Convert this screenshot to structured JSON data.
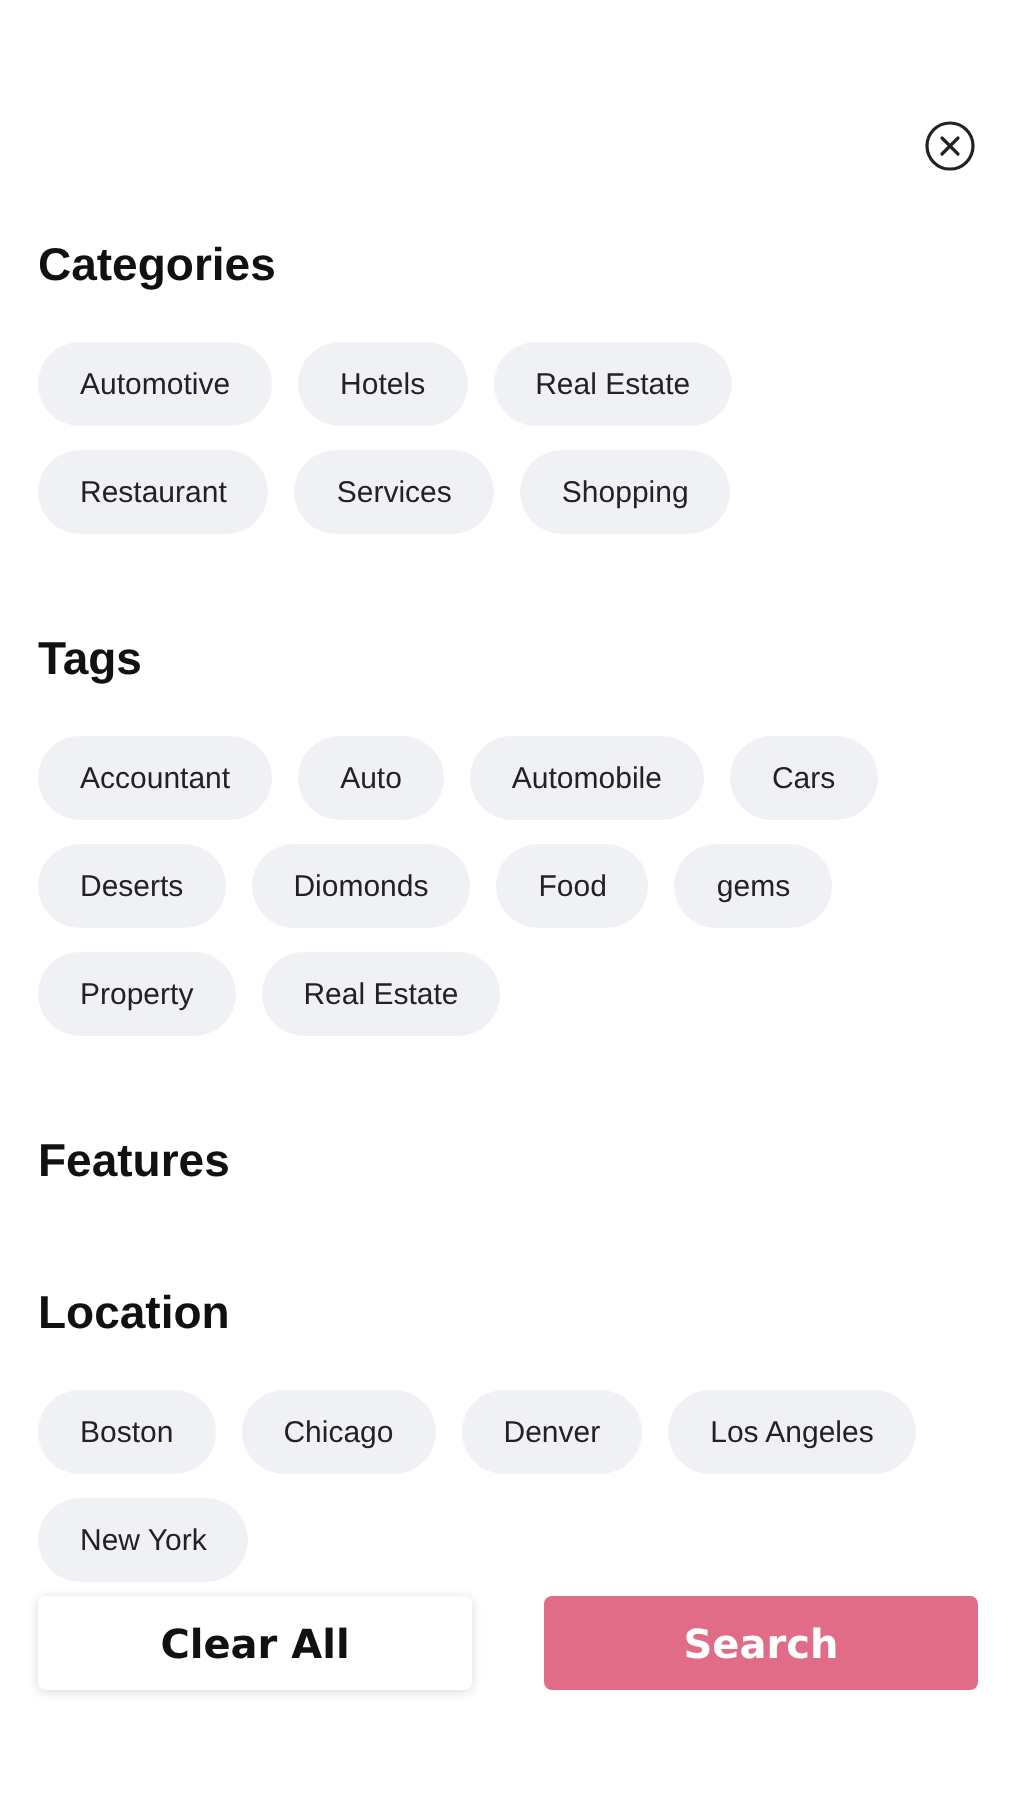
{
  "sections": [
    {
      "title": "Categories",
      "chips": [
        {
          "label": "Automotive"
        },
        {
          "label": "Hotels"
        },
        {
          "label": "Real Estate"
        },
        {
          "label": "Restaurant"
        },
        {
          "label": "Services"
        },
        {
          "label": "Shopping"
        }
      ]
    },
    {
      "title": "Tags",
      "chips": [
        {
          "label": "Accountant"
        },
        {
          "label": "Auto"
        },
        {
          "label": "Automobile"
        },
        {
          "label": "Cars"
        },
        {
          "label": "Deserts"
        },
        {
          "label": "Diomonds"
        },
        {
          "label": "Food"
        },
        {
          "label": "gems"
        },
        {
          "label": "Property"
        },
        {
          "label": "Real Estate"
        }
      ]
    },
    {
      "title": "Features"
    },
    {
      "title": "Location",
      "chips": [
        {
          "label": "Boston"
        },
        {
          "label": "Chicago"
        },
        {
          "label": "Denver"
        },
        {
          "label": "Los Angeles"
        },
        {
          "label": "New York"
        }
      ]
    }
  ],
  "buttons": {
    "clear": "Clear All",
    "search": "Search"
  }
}
